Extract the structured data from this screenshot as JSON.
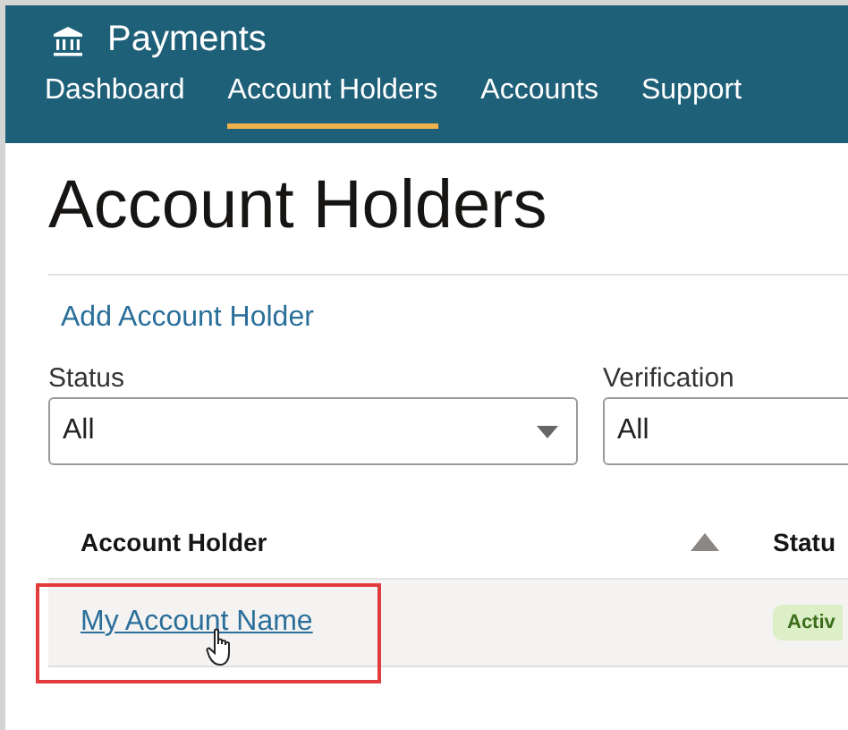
{
  "app": {
    "title": "Payments"
  },
  "nav": [
    {
      "label": "Dashboard",
      "selected": false
    },
    {
      "label": "Account Holders",
      "selected": true
    },
    {
      "label": "Accounts",
      "selected": false
    },
    {
      "label": "Support",
      "selected": false
    }
  ],
  "page_title": "Account Holders",
  "add_link": "Add Account Holder",
  "filters": [
    {
      "label": "Status",
      "value": "All"
    },
    {
      "label": "Verification",
      "value": "All"
    }
  ],
  "table": {
    "columns": [
      {
        "label": "Account Holder"
      },
      {
        "label": "Statu"
      }
    ],
    "rows": [
      {
        "name": "My Account Name",
        "status": "Activ",
        "highlighted": true
      }
    ]
  }
}
